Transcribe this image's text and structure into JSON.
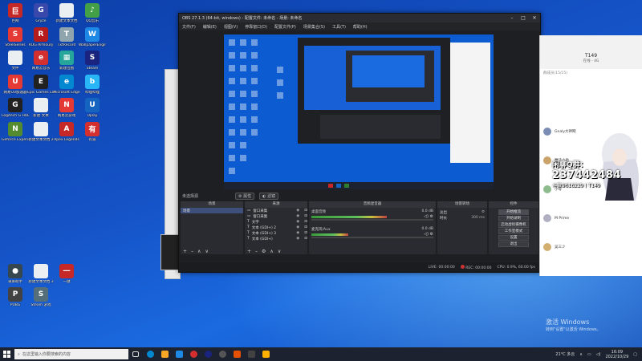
{
  "desktop_icons": [
    {
      "label": "巨网",
      "color": "#c62828",
      "glyph": "巨"
    },
    {
      "label": "Gryze",
      "color": "#3949ab",
      "glyph": "G"
    },
    {
      "label": "新建文本文档",
      "color": "#eceff1",
      "glyph": ""
    },
    {
      "label": "QQ音乐",
      "color": "#43a047",
      "glyph": "♪"
    },
    {
      "label": "SteelSeries",
      "color": "#e53935",
      "glyph": "S"
    },
    {
      "label": "ROG Armoury",
      "color": "#b71c1c",
      "glyph": "R"
    },
    {
      "label": "TxtRecord",
      "color": "#90a4ae",
      "glyph": "T"
    },
    {
      "label": "WallpaperEngine",
      "color": "#1e88e5",
      "glyph": "W"
    },
    {
      "label": "文件",
      "color": "#eceff1",
      "glyph": ""
    },
    {
      "label": "网易云音乐",
      "color": "#d32f2f",
      "glyph": "e"
    },
    {
      "label": "新建位图",
      "color": "#26a69a",
      "glyph": "▦"
    },
    {
      "label": "Steam",
      "color": "#1a237e",
      "glyph": "S"
    },
    {
      "label": "网易UU加速器",
      "color": "#e53935",
      "glyph": "U"
    },
    {
      "label": "Epic Games Launcher",
      "color": "#212121",
      "glyph": "E"
    },
    {
      "label": "Microsoft Edge",
      "color": "#0288d1",
      "glyph": "e"
    },
    {
      "label": "哔哩哔哩",
      "color": "#29b6f6",
      "glyph": "b"
    },
    {
      "label": "Logitech G HUB",
      "color": "#212121",
      "glyph": "G"
    },
    {
      "label": "新建 文本",
      "color": "#eceff1",
      "glyph": ""
    },
    {
      "label": "网易云游戏",
      "color": "#e53935",
      "glyph": "N"
    },
    {
      "label": "Uplay",
      "color": "#1565c0",
      "glyph": "U"
    },
    {
      "label": "Geforce Experience",
      "color": "#558b2f",
      "glyph": "N"
    },
    {
      "label": "新建文本文档 2",
      "color": "#eceff1",
      "glyph": ""
    },
    {
      "label": "Apex Legends",
      "color": "#c62828",
      "glyph": "A"
    },
    {
      "label": "有道",
      "color": "#d32f2f",
      "glyph": "有"
    },
    {
      "label": "录屏助手",
      "color": "#37474f",
      "glyph": "●"
    },
    {
      "label": "新建文本文档 3",
      "color": "#eceff1",
      "glyph": ""
    },
    {
      "label": "一键",
      "color": "#c62828",
      "glyph": "一"
    },
    {
      "label": "PUBG",
      "color": "#424242",
      "glyph": "P"
    },
    {
      "label": "Steam 游戏",
      "color": "#546e7a",
      "glyph": "S"
    }
  ],
  "obs": {
    "title": "OBS 27.1.3 (64-bit, windows) - 配置文件: 未命名 - 场景: 未命名",
    "menu": [
      "文件(F)",
      "编辑(E)",
      "视图(V)",
      "停靠窗口(D)",
      "配置文件(P)",
      "场景集合(S)",
      "工具(T)",
      "帮助(H)"
    ],
    "toolbar": {
      "left": "未选择源",
      "btn1": "属性",
      "btn2": "滤镜"
    },
    "docks": {
      "scenes": {
        "title": "场景",
        "items": [
          "场景"
        ]
      },
      "sources": {
        "title": "来源",
        "items": [
          "窗口采集",
          "窗口采集",
          "文字",
          "文本 (GDI+) 2",
          "文本 (GDI+) 3",
          "文本 (GDI+)"
        ]
      },
      "mixer": {
        "title": "音频混音器",
        "tracks": [
          {
            "name": "桌面音频",
            "db": "0.0 dB",
            "level": 0.62
          },
          {
            "name": "麦克风/Aux",
            "db": "0.0 dB",
            "level": 0.3
          }
        ]
      },
      "transitions": {
        "title": "场景转场",
        "value": "淡出",
        "duration_label": "时长",
        "duration": "300 ms"
      },
      "controls": {
        "title": "控件",
        "buttons": [
          "开始推流",
          "开始录制",
          "启动虚拟摄像机",
          "工作室模式",
          "设置",
          "退出"
        ]
      }
    },
    "status": {
      "live": "LIVE: 00:00:00",
      "rec": "REC: 00:00:00",
      "cpu": "CPU: 0.9%, 60.00 fps"
    }
  },
  "chat": {
    "title": "T149",
    "subtitle": "在线 - 4G",
    "members_label": "群成员(15/15)",
    "items": [
      "Gnaly大神网",
      "魔法小助",
      "小号",
      "M Prime",
      "吴三少"
    ]
  },
  "overlay": {
    "line1": "闲聊Q群：",
    "line2": "237442484",
    "line3": "斗鱼9616229丨T149"
  },
  "watermark": {
    "title": "激活 Windows",
    "subtitle": "转到\"设置\"以激活 Windows。"
  },
  "taskbar": {
    "search_placeholder": "在这里输入你要搜索的内容",
    "weather": "21°C 多云",
    "time": "16:09",
    "date": "2022/10/29"
  }
}
